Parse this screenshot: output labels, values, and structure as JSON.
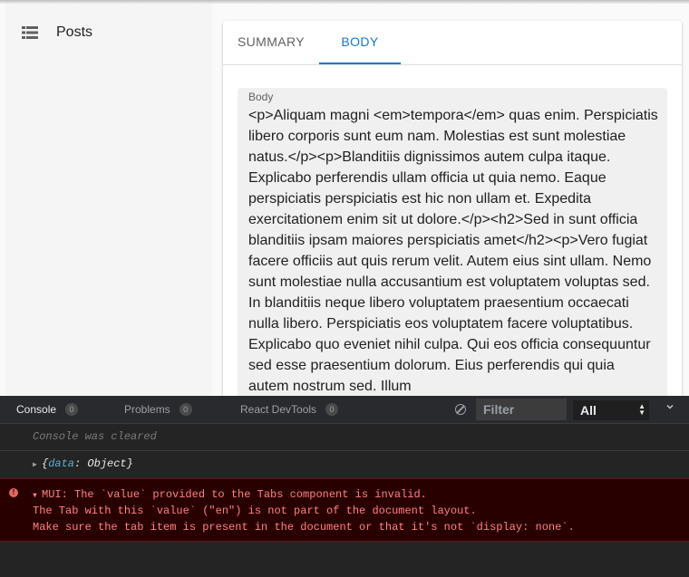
{
  "sidebar": {
    "items": [
      {
        "label": "Posts",
        "icon": "list-icon"
      }
    ]
  },
  "tabs": {
    "items": [
      {
        "label": "SUMMARY"
      },
      {
        "label": "BODY"
      }
    ],
    "active_color": "#1976d2"
  },
  "body_field": {
    "label": "Body",
    "value": "<p>Aliquam magni <em>tempora</em> quas enim. Perspiciatis libero corporis sunt eum nam. Molestias est sunt molestiae natus.</p><p>Blanditiis dignissimos autem culpa itaque. Explicabo perferendis ullam officia ut quia nemo. Eaque perspiciatis perspiciatis est hic non ullam et. Expedita exercitationem enim sit ut dolore.</p><h2>Sed in sunt officia blanditiis ipsam maiores perspiciatis amet</h2><p>Vero fugiat facere officiis aut quis rerum velit. Autem eius sint ullam. Nemo sunt molestiae nulla accusantium est voluptatem voluptas sed. In blanditiis neque libero voluptatem praesentium occaecati nulla libero. Perspiciatis eos voluptatem facere voluptatibus. Explicabo quo eveniet nihil culpa. Qui eos officia consequuntur sed esse praesentium dolorum. Eius perferendis qui quia autem nostrum sed. Illum"
  },
  "devtools": {
    "tabs": [
      {
        "label": "Console",
        "count": "0"
      },
      {
        "label": "Problems",
        "count": "0"
      },
      {
        "label": "React DevTools",
        "count": "0"
      }
    ],
    "filter_placeholder": "Filter",
    "level": "All",
    "console": {
      "cleared": "Console was cleared",
      "object_open": "{",
      "object_key": "data",
      "object_rest": ": Object}",
      "error_lines": [
        "MUI: The `value` provided to the Tabs component is invalid.",
        "The Tab with this `value` (\"en\") is not part of the document layout.",
        "Make sure the tab item is present in the document or that it's not `display: none`."
      ]
    }
  }
}
